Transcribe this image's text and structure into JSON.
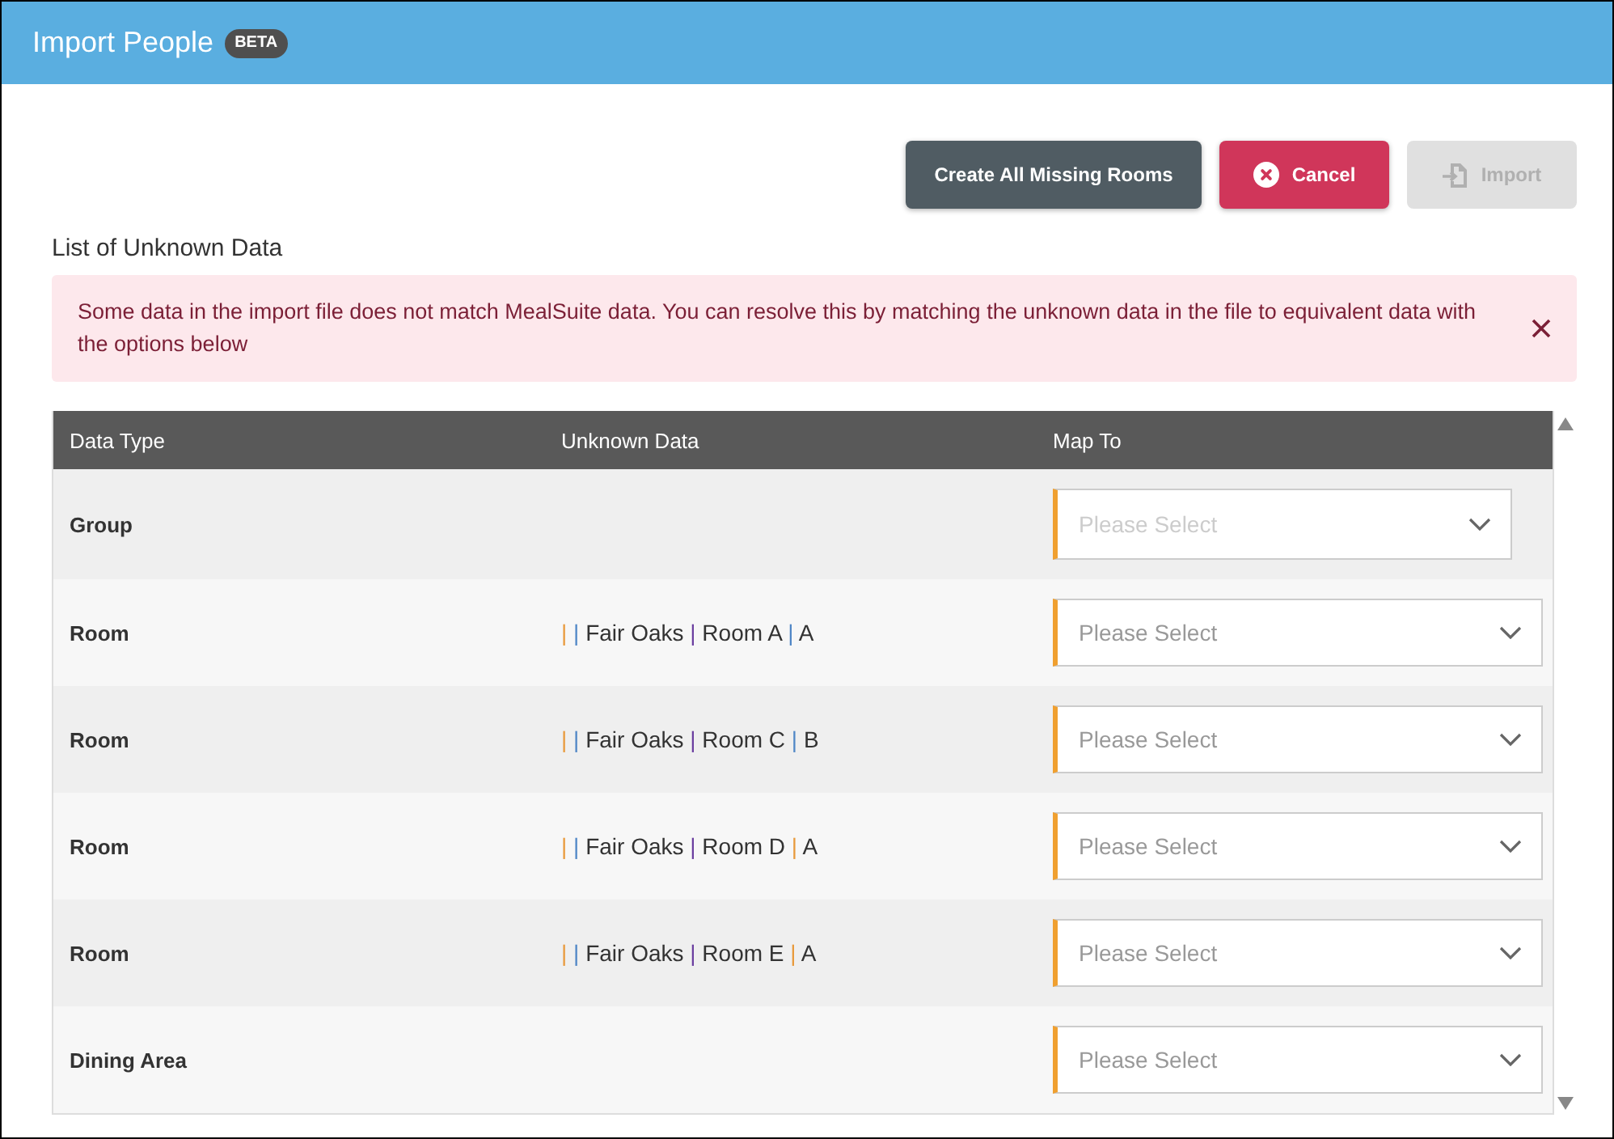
{
  "header": {
    "title": "Import People",
    "badge": "BETA"
  },
  "actions": [
    {
      "kind": "create",
      "label": "Create All Missing Rooms",
      "disabled": false
    },
    {
      "kind": "cancel",
      "label": "Cancel",
      "disabled": false
    },
    {
      "kind": "import",
      "label": "Import",
      "disabled": true
    }
  ],
  "section_title": "List of Unknown Data",
  "alert": {
    "message": "Some data in the import file does not match MealSuite data. You can resolve this by matching the unknown data in the file to equivalent data with the options below",
    "dismissible": true
  },
  "table": {
    "columns": [
      "Data Type",
      "Unknown Data",
      "Map To"
    ],
    "rows": [
      {
        "data_type": "Group",
        "map_to": {
          "placeholder": "Please Select",
          "disabled": true
        }
      },
      {
        "data_type": "Room",
        "unknown_data": [
          {
            "text": "|",
            "color": "#e89a3c"
          },
          {
            "text": "|",
            "color": "#4f86c6"
          },
          {
            "text": "Fair Oaks"
          },
          {
            "text": "|",
            "color": "#6b3fa0"
          },
          {
            "text": "Room A"
          },
          {
            "text": "|",
            "color": "#4f86c6"
          },
          {
            "text": "A"
          }
        ],
        "map_to": {
          "placeholder": "Please Select",
          "disabled": false
        }
      },
      {
        "data_type": "Room",
        "unknown_data": [
          {
            "text": "|",
            "color": "#e89a3c"
          },
          {
            "text": "|",
            "color": "#4f86c6"
          },
          {
            "text": "Fair Oaks"
          },
          {
            "text": "|",
            "color": "#6b3fa0"
          },
          {
            "text": "Room C"
          },
          {
            "text": "|",
            "color": "#4f86c6"
          },
          {
            "text": "B"
          }
        ],
        "map_to": {
          "placeholder": "Please Select",
          "disabled": false
        }
      },
      {
        "data_type": "Room",
        "unknown_data": [
          {
            "text": "|",
            "color": "#e89a3c"
          },
          {
            "text": "|",
            "color": "#4f86c6"
          },
          {
            "text": "Fair Oaks"
          },
          {
            "text": "|",
            "color": "#6b3fa0"
          },
          {
            "text": "Room D"
          },
          {
            "text": "|",
            "color": "#e89a3c"
          },
          {
            "text": "A"
          }
        ],
        "map_to": {
          "placeholder": "Please Select",
          "disabled": false
        }
      },
      {
        "data_type": "Room",
        "unknown_data": [
          {
            "text": "|",
            "color": "#e89a3c"
          },
          {
            "text": "|",
            "color": "#4f86c6"
          },
          {
            "text": "Fair Oaks"
          },
          {
            "text": "|",
            "color": "#6b3fa0"
          },
          {
            "text": "Room E"
          },
          {
            "text": "|",
            "color": "#e89a3c"
          },
          {
            "text": "A"
          }
        ],
        "map_to": {
          "placeholder": "Please Select",
          "disabled": false
        }
      },
      {
        "data_type": "Dining Area",
        "map_to": {
          "placeholder": "Please Select",
          "disabled": false
        }
      }
    ]
  }
}
